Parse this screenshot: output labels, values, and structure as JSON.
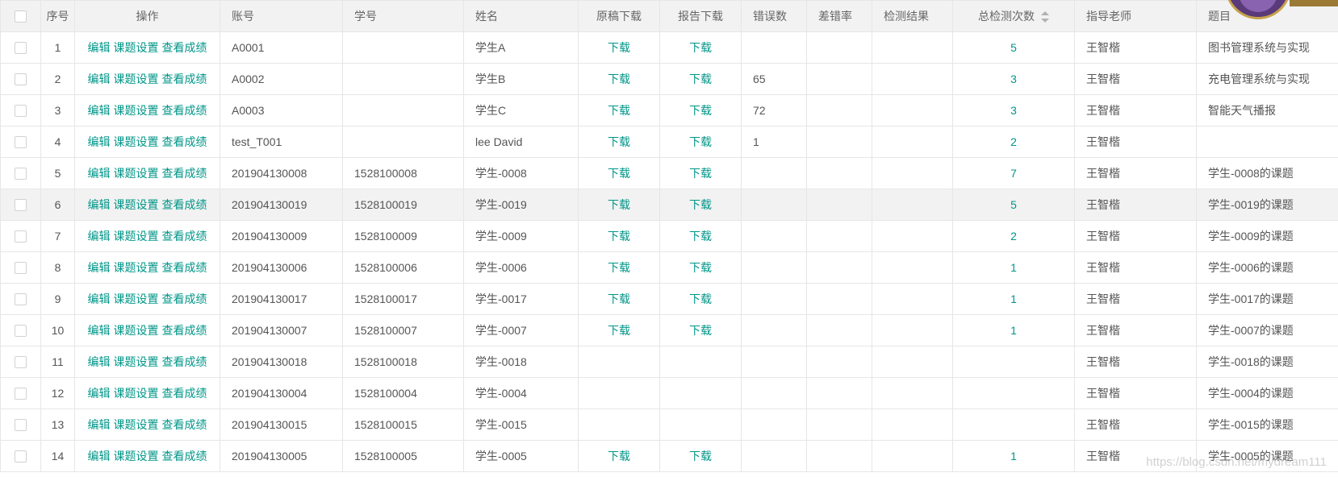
{
  "header": {
    "index": "序号",
    "actions": "操作",
    "account": "账号",
    "student_no": "学号",
    "name": "姓名",
    "draft_download": "原稿下载",
    "report_download": "报告下载",
    "error_count": "错误数",
    "error_rate": "差错率",
    "check_result": "检测结果",
    "total_checks": "总检测次数",
    "teacher": "指导老师",
    "topic": "题目"
  },
  "actions": {
    "edit": "编辑",
    "topic_settings": "课题设置",
    "view_scores": "查看成绩"
  },
  "download_label": "下载",
  "rows": [
    {
      "index": "1",
      "account": "A0001",
      "student_no": "",
      "name": "学生A",
      "draft": "下载",
      "report": "下载",
      "errors": "",
      "rate": "",
      "result": "",
      "total": "5",
      "teacher": "王智楷",
      "topic": "图书管理系统与实现"
    },
    {
      "index": "2",
      "account": "A0002",
      "student_no": "",
      "name": "学生B",
      "draft": "下载",
      "report": "下载",
      "errors": "65",
      "rate": "",
      "result": "",
      "total": "3",
      "teacher": "王智楷",
      "topic": "充电管理系统与实现"
    },
    {
      "index": "3",
      "account": "A0003",
      "student_no": "",
      "name": "学生C",
      "draft": "下载",
      "report": "下载",
      "errors": "72",
      "rate": "",
      "result": "",
      "total": "3",
      "teacher": "王智楷",
      "topic": "智能天气播报"
    },
    {
      "index": "4",
      "account": "test_T001",
      "student_no": "",
      "name": "lee David",
      "draft": "下载",
      "report": "下载",
      "errors": "1",
      "rate": "",
      "result": "",
      "total": "2",
      "teacher": "王智楷",
      "topic": ""
    },
    {
      "index": "5",
      "account": "201904130008",
      "student_no": "1528100008",
      "name": "学生-0008",
      "draft": "下载",
      "report": "下载",
      "errors": "",
      "rate": "",
      "result": "",
      "total": "7",
      "teacher": "王智楷",
      "topic": "学生-0008的课题"
    },
    {
      "index": "6",
      "account": "201904130019",
      "student_no": "1528100019",
      "name": "学生-0019",
      "draft": "下载",
      "report": "下载",
      "errors": "",
      "rate": "",
      "result": "",
      "total": "5",
      "teacher": "王智楷",
      "topic": "学生-0019的课题"
    },
    {
      "index": "7",
      "account": "201904130009",
      "student_no": "1528100009",
      "name": "学生-0009",
      "draft": "下载",
      "report": "下载",
      "errors": "",
      "rate": "",
      "result": "",
      "total": "2",
      "teacher": "王智楷",
      "topic": "学生-0009的课题"
    },
    {
      "index": "8",
      "account": "201904130006",
      "student_no": "1528100006",
      "name": "学生-0006",
      "draft": "下载",
      "report": "下载",
      "errors": "",
      "rate": "",
      "result": "",
      "total": "1",
      "teacher": "王智楷",
      "topic": "学生-0006的课题"
    },
    {
      "index": "9",
      "account": "201904130017",
      "student_no": "1528100017",
      "name": "学生-0017",
      "draft": "下载",
      "report": "下载",
      "errors": "",
      "rate": "",
      "result": "",
      "total": "1",
      "teacher": "王智楷",
      "topic": "学生-0017的课题"
    },
    {
      "index": "10",
      "account": "201904130007",
      "student_no": "1528100007",
      "name": "学生-0007",
      "draft": "下载",
      "report": "下载",
      "errors": "",
      "rate": "",
      "result": "",
      "total": "1",
      "teacher": "王智楷",
      "topic": "学生-0007的课题"
    },
    {
      "index": "11",
      "account": "201904130018",
      "student_no": "1528100018",
      "name": "学生-0018",
      "draft": "",
      "report": "",
      "errors": "",
      "rate": "",
      "result": "",
      "total": "",
      "teacher": "王智楷",
      "topic": "学生-0018的课题"
    },
    {
      "index": "12",
      "account": "201904130004",
      "student_no": "1528100004",
      "name": "学生-0004",
      "draft": "",
      "report": "",
      "errors": "",
      "rate": "",
      "result": "",
      "total": "",
      "teacher": "王智楷",
      "topic": "学生-0004的课题"
    },
    {
      "index": "13",
      "account": "201904130015",
      "student_no": "1528100015",
      "name": "学生-0015",
      "draft": "",
      "report": "",
      "errors": "",
      "rate": "",
      "result": "",
      "total": "",
      "teacher": "王智楷",
      "topic": "学生-0015的课题"
    },
    {
      "index": "14",
      "account": "201904130005",
      "student_no": "1528100005",
      "name": "学生-0005",
      "draft": "下载",
      "report": "下载",
      "errors": "",
      "rate": "",
      "result": "",
      "total": "1",
      "teacher": "王智楷",
      "topic": "学生-0005的课题"
    }
  ],
  "hover_row": 5,
  "watermark": "https://blog.csdn.net/mydream111",
  "colors": {
    "link": "#009688",
    "header_bg": "#f2f2f2",
    "border": "#e6e6e6",
    "text": "#555555"
  },
  "icons": {
    "sort": "sort-caret-icon",
    "checkbox": "checkbox-icon",
    "avatar": "avatar-badge-icon"
  }
}
